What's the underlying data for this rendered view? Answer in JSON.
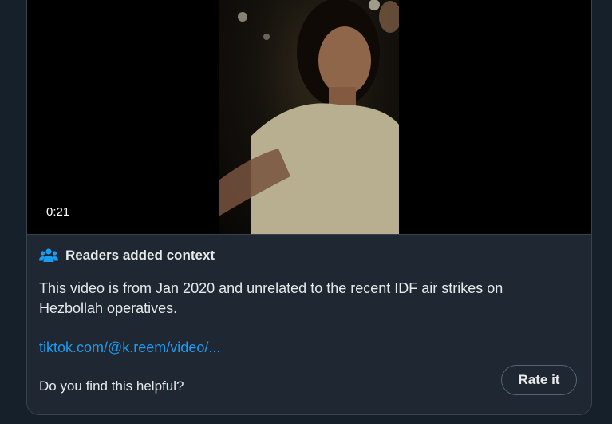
{
  "video": {
    "duration": "0:21"
  },
  "context": {
    "title": "Readers added context",
    "icon": "people-icon",
    "body": "This video is from Jan 2020 and unrelated to the recent IDF air strikes on Hezbollah operatives.",
    "link": "tiktok.com/@k.reem/video/...",
    "helpful_question": "Do you find this helpful?",
    "rate_label": "Rate it"
  },
  "colors": {
    "background": "#15202b",
    "card": "#1e2732",
    "border": "#38444d",
    "text": "#e7e9ea",
    "link": "#1d9bf0",
    "icon": "#1d9bf0"
  }
}
